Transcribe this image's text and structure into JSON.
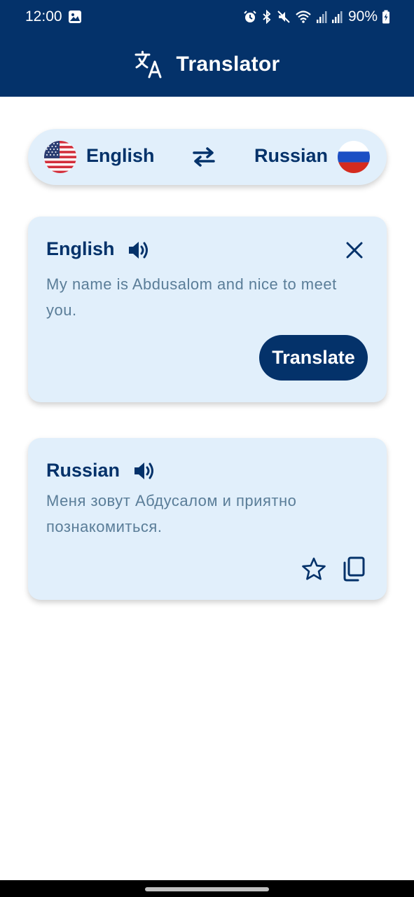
{
  "status_bar": {
    "time": "12:00",
    "battery": "90%",
    "icons": [
      "gallery-icon",
      "alarm-icon",
      "bluetooth-icon",
      "mute-icon",
      "wifi-icon",
      "signal-icon",
      "signal-icon",
      "battery-charging-icon"
    ]
  },
  "app_bar": {
    "title": "Translator",
    "icon": "translate-icon",
    "background": "#04326a"
  },
  "language_bar": {
    "source_language": "English",
    "source_flag": "us-flag-icon",
    "target_language": "Russian",
    "target_flag": "russia-flag-icon",
    "swap_icon": "swap-arrows-icon"
  },
  "input_card": {
    "title": "English",
    "text": "My name is Abdusalom and nice to meet you.",
    "translate_label": "Translate",
    "speaker_icon": "volume-icon",
    "clear_icon": "close-icon"
  },
  "output_card": {
    "title": "Russian",
    "text": "Меня зовут Абдусалом и приятно познакомиться.",
    "speaker_icon": "volume-icon",
    "favorite_icon": "star-outline-icon",
    "copy_icon": "copy-icon"
  },
  "colors": {
    "primary": "#04326a",
    "card_background": "#e1effb",
    "secondary_text": "#5a7d98"
  }
}
